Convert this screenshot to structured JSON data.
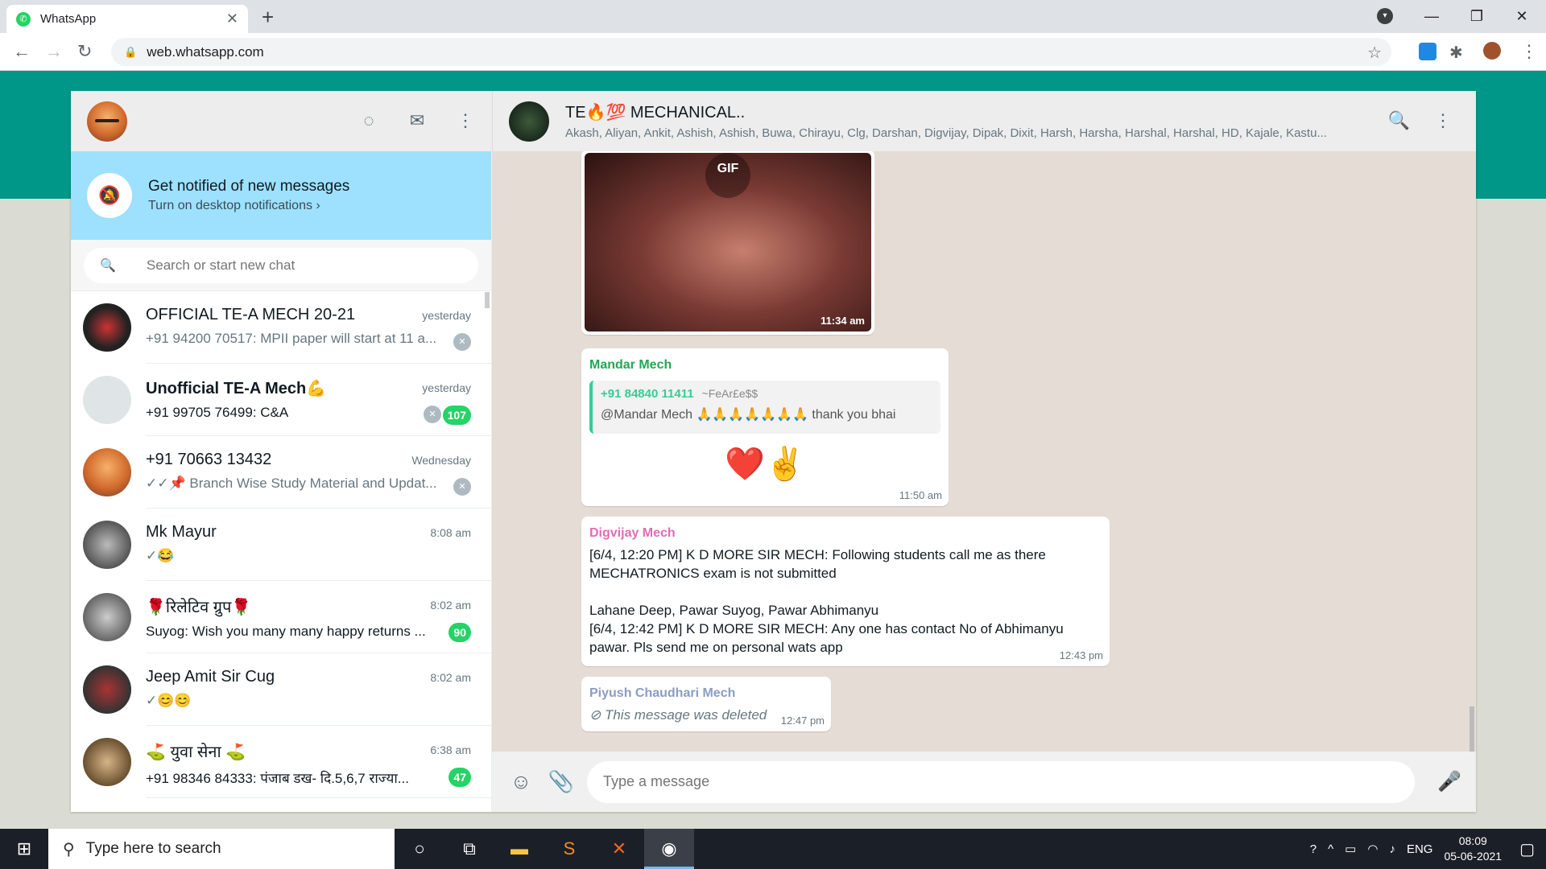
{
  "browser": {
    "tab_title": "WhatsApp",
    "url": "web.whatsapp.com"
  },
  "sidebar": {
    "notification": {
      "title": "Get notified of new messages",
      "subtitle": "Turn on desktop notifications ›"
    },
    "search_placeholder": "Search or start new chat",
    "chats": [
      {
        "name": "OFFICIAL TE-A MECH 20-21",
        "time": "yesterday",
        "preview": "+91 94200 70517: MPII paper will start at 11 a...",
        "unread": "",
        "bold": false
      },
      {
        "name": "Unofficial TE-A Mech💪",
        "time": "yesterday",
        "preview": "+91 99705 76499: C&A",
        "unread": "107",
        "bold": true
      },
      {
        "name": "+91 70663 13432",
        "time": "Wednesday",
        "preview": "✓✓📌 Branch Wise Study Material and Updat...",
        "unread": "",
        "bold": false
      },
      {
        "name": "Mk Mayur",
        "time": "8:08 am",
        "preview": "✓😂",
        "unread": "",
        "bold": false
      },
      {
        "name": "🌹रिलेटिव ग्रुप🌹",
        "time": "8:02 am",
        "preview": "Suyog: Wish you many many happy returns ...",
        "unread": "90",
        "bold": false
      },
      {
        "name": "Jeep Amit Sir Cug",
        "time": "8:02 am",
        "preview": "✓😊😊",
        "unread": "",
        "bold": false
      },
      {
        "name": "⛳ युवा सेना ⛳",
        "time": "6:38 am",
        "preview": "+91 98346 84333: पंजाब डख- दि.5,6,7 राज्या...",
        "unread": "47",
        "bold": false
      }
    ]
  },
  "conversation": {
    "group_name": "TE🔥💯 MECHANICAL..",
    "members": "Akash, Aliyan, Ankit, Ashish, Ashish, Buwa, Chirayu, Clg, Darshan, Digvijay, Dipak, Dixit, Harsh, Harsha, Harshal, Harshal, HD, Kajale, Kastu...",
    "gif": {
      "label": "GIF",
      "time": "11:34 am"
    },
    "msg1": {
      "sender": "Mandar Mech",
      "sender_color": "#1fa855",
      "quote_phone": "+91 84840 11411",
      "quote_alias": "~FeAr£e$$",
      "quote_text": "@Mandar Mech 🙏🙏🙏🙏🙏🙏🙏 thank you bhai",
      "body": "❤️✌️",
      "time": "11:50 am"
    },
    "msg2": {
      "sender": "Digvijay Mech",
      "sender_color": "#e36bb5",
      "body": "[6/4, 12:20 PM] K D MORE SIR MECH: Following students call me as there MECHATRONICS exam is not submitted\n\nLahane Deep, Pawar Suyog, Pawar Abhimanyu\n[6/4, 12:42 PM] K D MORE SIR MECH: Any one has contact No of Abhimanyu pawar. Pls send me on personal wats app",
      "time": "12:43 pm"
    },
    "msg3": {
      "sender": "Piyush Chaudhari Mech",
      "sender_color": "#8b9dc3",
      "body": "This message was deleted",
      "time": "12:47 pm"
    },
    "composer_placeholder": "Type a message"
  },
  "taskbar": {
    "search_placeholder": "Type here to search",
    "lang": "ENG",
    "time": "08:09",
    "date": "05-06-2021"
  }
}
